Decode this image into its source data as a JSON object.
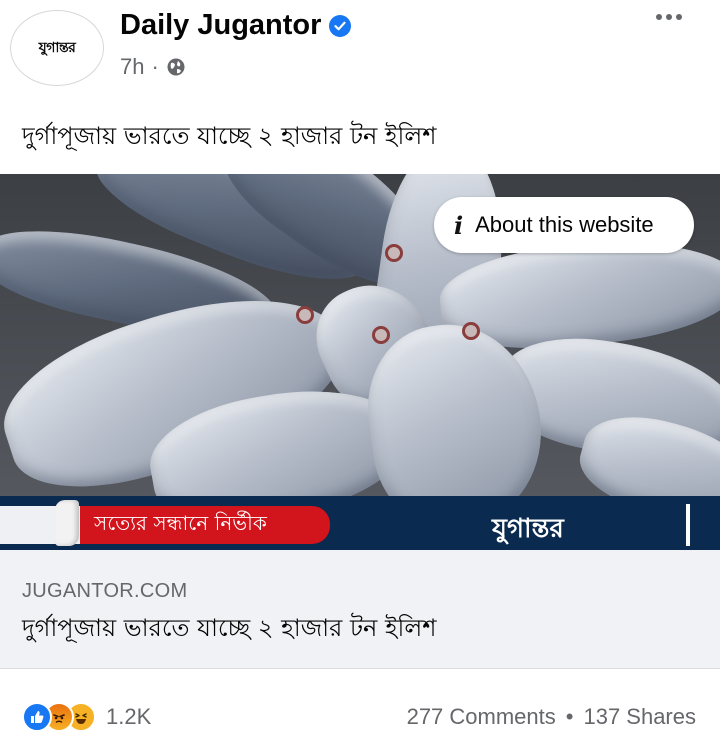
{
  "post": {
    "page_name": "Daily Jugantor",
    "avatar_logo_text": "যুগান্তর",
    "time": "7h",
    "separator": "·",
    "text": "দুর্গাপূজায় ভারতে যাচ্ছে ২ হাজার টন ইলিশ",
    "icons": {
      "verified": "verified-badge",
      "privacy": "globe-icon",
      "more": "more-icon"
    }
  },
  "link": {
    "about_label": "About this website",
    "about_icon": "info-icon",
    "banner_slogan": "সত্যের সন্ধানে নির্ভীক",
    "banner_logo_text": "যুগান্তর",
    "domain": "JUGANTOR.COM",
    "title": "দুর্গাপূজায় ভারতে যাচ্ছে ২ হাজার টন ইলিশ"
  },
  "footer": {
    "reaction_count": "1.2K",
    "reactions": [
      "like-icon",
      "angry-icon",
      "haha-icon"
    ],
    "comments": "277 Comments",
    "separator": "•",
    "shares": "137 Shares"
  },
  "colors": {
    "brand_blue": "#1877f2",
    "secondary_text": "#65676b",
    "banner_navy": "#0a2a4f",
    "banner_red": "#d2141c",
    "preview_bg": "#f0f2f5"
  }
}
